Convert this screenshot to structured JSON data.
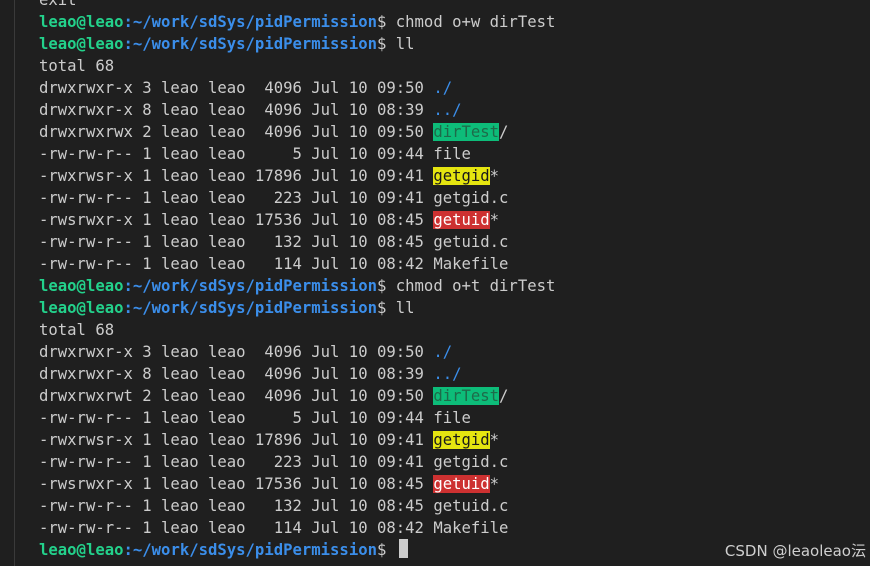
{
  "prompt": {
    "user": "leao@leao",
    "path": ":~/work/sdSys/pidPermission",
    "suffix": "$ "
  },
  "lines": [
    {
      "plain": "exit"
    },
    {
      "prompt": true,
      "cmd": "chmod o+w dirTest"
    },
    {
      "prompt": true,
      "cmd": "ll"
    },
    {
      "plain": "total 68"
    },
    {
      "ls": "drwxrwxr-x 3 leao leao  4096 Jul 10 09:50 ",
      "name": "./",
      "style": "dir",
      "suffix": ""
    },
    {
      "ls": "drwxrwxr-x 8 leao leao  4096 Jul 10 08:39 ",
      "name": "../",
      "style": "dir",
      "suffix": ""
    },
    {
      "ls": "drwxrwxrwx 2 leao leao  4096 Jul 10 09:50 ",
      "name": "dirTest",
      "style": "hl-green",
      "suffix": "/"
    },
    {
      "ls": "-rw-rw-r-- 1 leao leao     5 Jul 10 09:44 ",
      "name": "file",
      "style": "",
      "suffix": ""
    },
    {
      "ls": "-rwxrwsr-x 1 leao leao 17896 Jul 10 09:41 ",
      "name": "getgid",
      "style": "hl-yellow",
      "suffix": "*"
    },
    {
      "ls": "-rw-rw-r-- 1 leao leao   223 Jul 10 09:41 ",
      "name": "getgid.c",
      "style": "",
      "suffix": ""
    },
    {
      "ls": "-rwsrwxr-x 1 leao leao 17536 Jul 10 08:45 ",
      "name": "getuid",
      "style": "hl-red",
      "suffix": "*"
    },
    {
      "ls": "-rw-rw-r-- 1 leao leao   132 Jul 10 08:45 ",
      "name": "getuid.c",
      "style": "",
      "suffix": ""
    },
    {
      "ls": "-rw-rw-r-- 1 leao leao   114 Jul 10 08:42 ",
      "name": "Makefile",
      "style": "",
      "suffix": ""
    },
    {
      "prompt": true,
      "cmd": "chmod o+t dirTest"
    },
    {
      "prompt": true,
      "cmd": "ll"
    },
    {
      "plain": "total 68"
    },
    {
      "ls": "drwxrwxr-x 3 leao leao  4096 Jul 10 09:50 ",
      "name": "./",
      "style": "dir",
      "suffix": ""
    },
    {
      "ls": "drwxrwxr-x 8 leao leao  4096 Jul 10 08:39 ",
      "name": "../",
      "style": "dir",
      "suffix": ""
    },
    {
      "ls": "drwxrwxrwt 2 leao leao  4096 Jul 10 09:50 ",
      "name": "dirTest",
      "style": "hl-green",
      "suffix": "/"
    },
    {
      "ls": "-rw-rw-r-- 1 leao leao     5 Jul 10 09:44 ",
      "name": "file",
      "style": "",
      "suffix": ""
    },
    {
      "ls": "-rwxrwsr-x 1 leao leao 17896 Jul 10 09:41 ",
      "name": "getgid",
      "style": "hl-yellow",
      "suffix": "*"
    },
    {
      "ls": "-rw-rw-r-- 1 leao leao   223 Jul 10 09:41 ",
      "name": "getgid.c",
      "style": "",
      "suffix": ""
    },
    {
      "ls": "-rwsrwxr-x 1 leao leao 17536 Jul 10 08:45 ",
      "name": "getuid",
      "style": "hl-red",
      "suffix": "*"
    },
    {
      "ls": "-rw-rw-r-- 1 leao leao   132 Jul 10 08:45 ",
      "name": "getuid.c",
      "style": "",
      "suffix": ""
    },
    {
      "ls": "-rw-rw-r-- 1 leao leao   114 Jul 10 08:42 ",
      "name": "Makefile",
      "style": "",
      "suffix": ""
    },
    {
      "prompt": true,
      "cmd": "",
      "cursor": true
    }
  ],
  "watermark": "CSDN @leaoleao沄"
}
